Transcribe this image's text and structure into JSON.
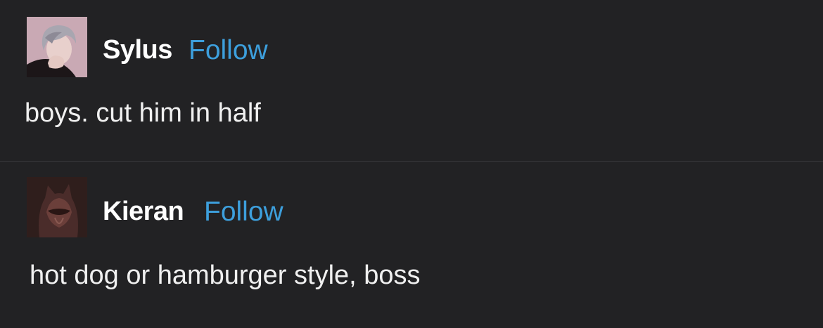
{
  "posts": [
    {
      "username": "Sylus",
      "follow_label": "Follow",
      "text": "boys. cut him in half",
      "avatar_icon": "user-avatar-white-hair"
    },
    {
      "username": "Kieran",
      "follow_label": "Follow",
      "text": "hot dog or hamburger style, boss",
      "avatar_icon": "user-avatar-masked"
    }
  ],
  "colors": {
    "background": "#222224",
    "divider": "#3a3a3d",
    "follow": "#3d9fdc",
    "text": "#f0f0f0"
  }
}
